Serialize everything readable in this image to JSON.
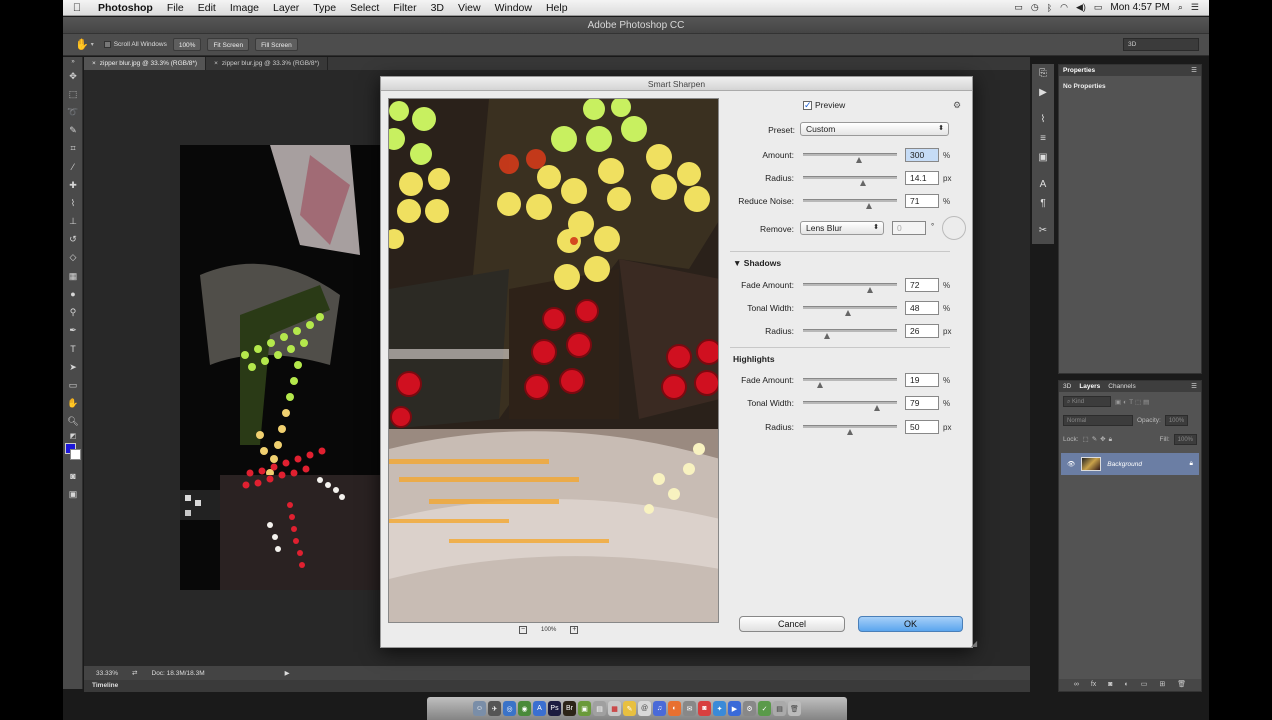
{
  "menubar": {
    "apple": "",
    "items": [
      "Photoshop",
      "File",
      "Edit",
      "Image",
      "Layer",
      "Type",
      "Select",
      "Filter",
      "3D",
      "View",
      "Window",
      "Help"
    ],
    "clock": "Mon 4:57 PM"
  },
  "window": {
    "title": "Adobe Photoshop CC"
  },
  "options": {
    "scroll_all": "Scroll All Windows",
    "zoom_btn": "100%",
    "fit_btn": "Fit Screen",
    "fill_btn": "Fill Screen",
    "workspace": "3D"
  },
  "tabs": [
    {
      "label": "zipper blur.jpg @ 33.3% (RGB/8*)",
      "close": "×"
    },
    {
      "label": "zipper blur.jpg @ 33.3% (RGB/8*)",
      "close": "×"
    }
  ],
  "status": {
    "zoom": "33.33%",
    "doc": "Doc: 18.3M/18.3M"
  },
  "timeline": {
    "label": "Timeline"
  },
  "properties": {
    "tab": "Properties",
    "content": "No Properties"
  },
  "layers": {
    "tabs": [
      "3D",
      "Layers",
      "Channels"
    ],
    "kind": "Kind",
    "blend": "Normal",
    "opacity_label": "Opacity:",
    "opacity": "100%",
    "lock_label": "Lock:",
    "fill_label": "Fill:",
    "fill": "100%",
    "layer_name": "Background"
  },
  "dialog": {
    "title": "Smart Sharpen",
    "preview_label": "Preview",
    "preset_label": "Preset:",
    "preset_value": "Custom",
    "amount_label": "Amount:",
    "amount": "300",
    "amount_unit": "%",
    "amount_level": 0.6,
    "radius_label": "Radius:",
    "radius": "14.1",
    "radius_unit": "px",
    "radius_level": 0.64,
    "noise_label": "Reduce Noise:",
    "noise": "71",
    "noise_unit": "%",
    "noise_level": 0.71,
    "remove_label": "Remove:",
    "remove_value": "Lens Blur",
    "angle": "0",
    "angle_unit": "°",
    "shadows_title": "▼ Shadows",
    "s_fade_label": "Fade Amount:",
    "s_fade": "72",
    "s_fade_unit": "%",
    "s_fade_level": 0.72,
    "s_tonal_label": "Tonal Width:",
    "s_tonal": "48",
    "s_tonal_unit": "%",
    "s_tonal_level": 0.48,
    "s_radius_label": "Radius:",
    "s_radius": "26",
    "s_radius_unit": "px",
    "s_radius_level": 0.26,
    "highlights_title": "Highlights",
    "h_fade_label": "Fade Amount:",
    "h_fade": "19",
    "h_fade_unit": "%",
    "h_fade_level": 0.19,
    "h_tonal_label": "Tonal Width:",
    "h_tonal": "79",
    "h_tonal_unit": "%",
    "h_tonal_level": 0.79,
    "h_radius_label": "Radius:",
    "h_radius": "50",
    "h_radius_unit": "px",
    "h_radius_level": 0.5,
    "zoom": "100%",
    "cancel": "Cancel",
    "ok": "OK"
  },
  "colors": {
    "accent": "#5ba5ee",
    "layer_selected": "#6b7ea4",
    "panel": "#535353"
  }
}
